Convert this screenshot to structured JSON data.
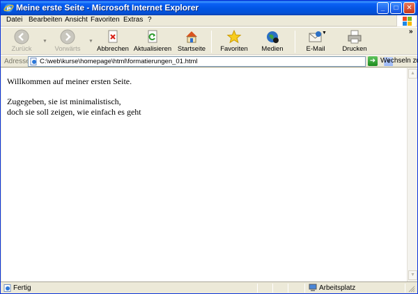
{
  "window": {
    "title": "Meine erste Seite - Microsoft Internet Explorer"
  },
  "menu": [
    "Datei",
    "Bearbeiten",
    "Ansicht",
    "Favoriten",
    "Extras",
    "?"
  ],
  "toolbar": {
    "back": "Zurück",
    "forward": "Vorwärts",
    "stop": "Abbrechen",
    "refresh": "Aktualisieren",
    "home": "Startseite",
    "favorites": "Favoriten",
    "media": "Medien",
    "mail": "E-Mail",
    "print": "Drucken"
  },
  "address": {
    "label": "Adresse",
    "url": "C:\\web\\kurse\\homepage\\html\\formatierungen_01.html",
    "go_label": "Wechseln zu"
  },
  "page": {
    "line1": "Willkommen auf meiner ersten Seite.",
    "line2": "Zugegeben, sie ist minimalistisch,",
    "line3": "doch sie soll zeigen, wie einfach es geht"
  },
  "status": {
    "text": "Fertig",
    "zone": "Arbeitsplatz"
  },
  "colors": {
    "titlebar": "#0054e3",
    "chrome": "#ece9d8",
    "content_bg": "#ffffff"
  }
}
